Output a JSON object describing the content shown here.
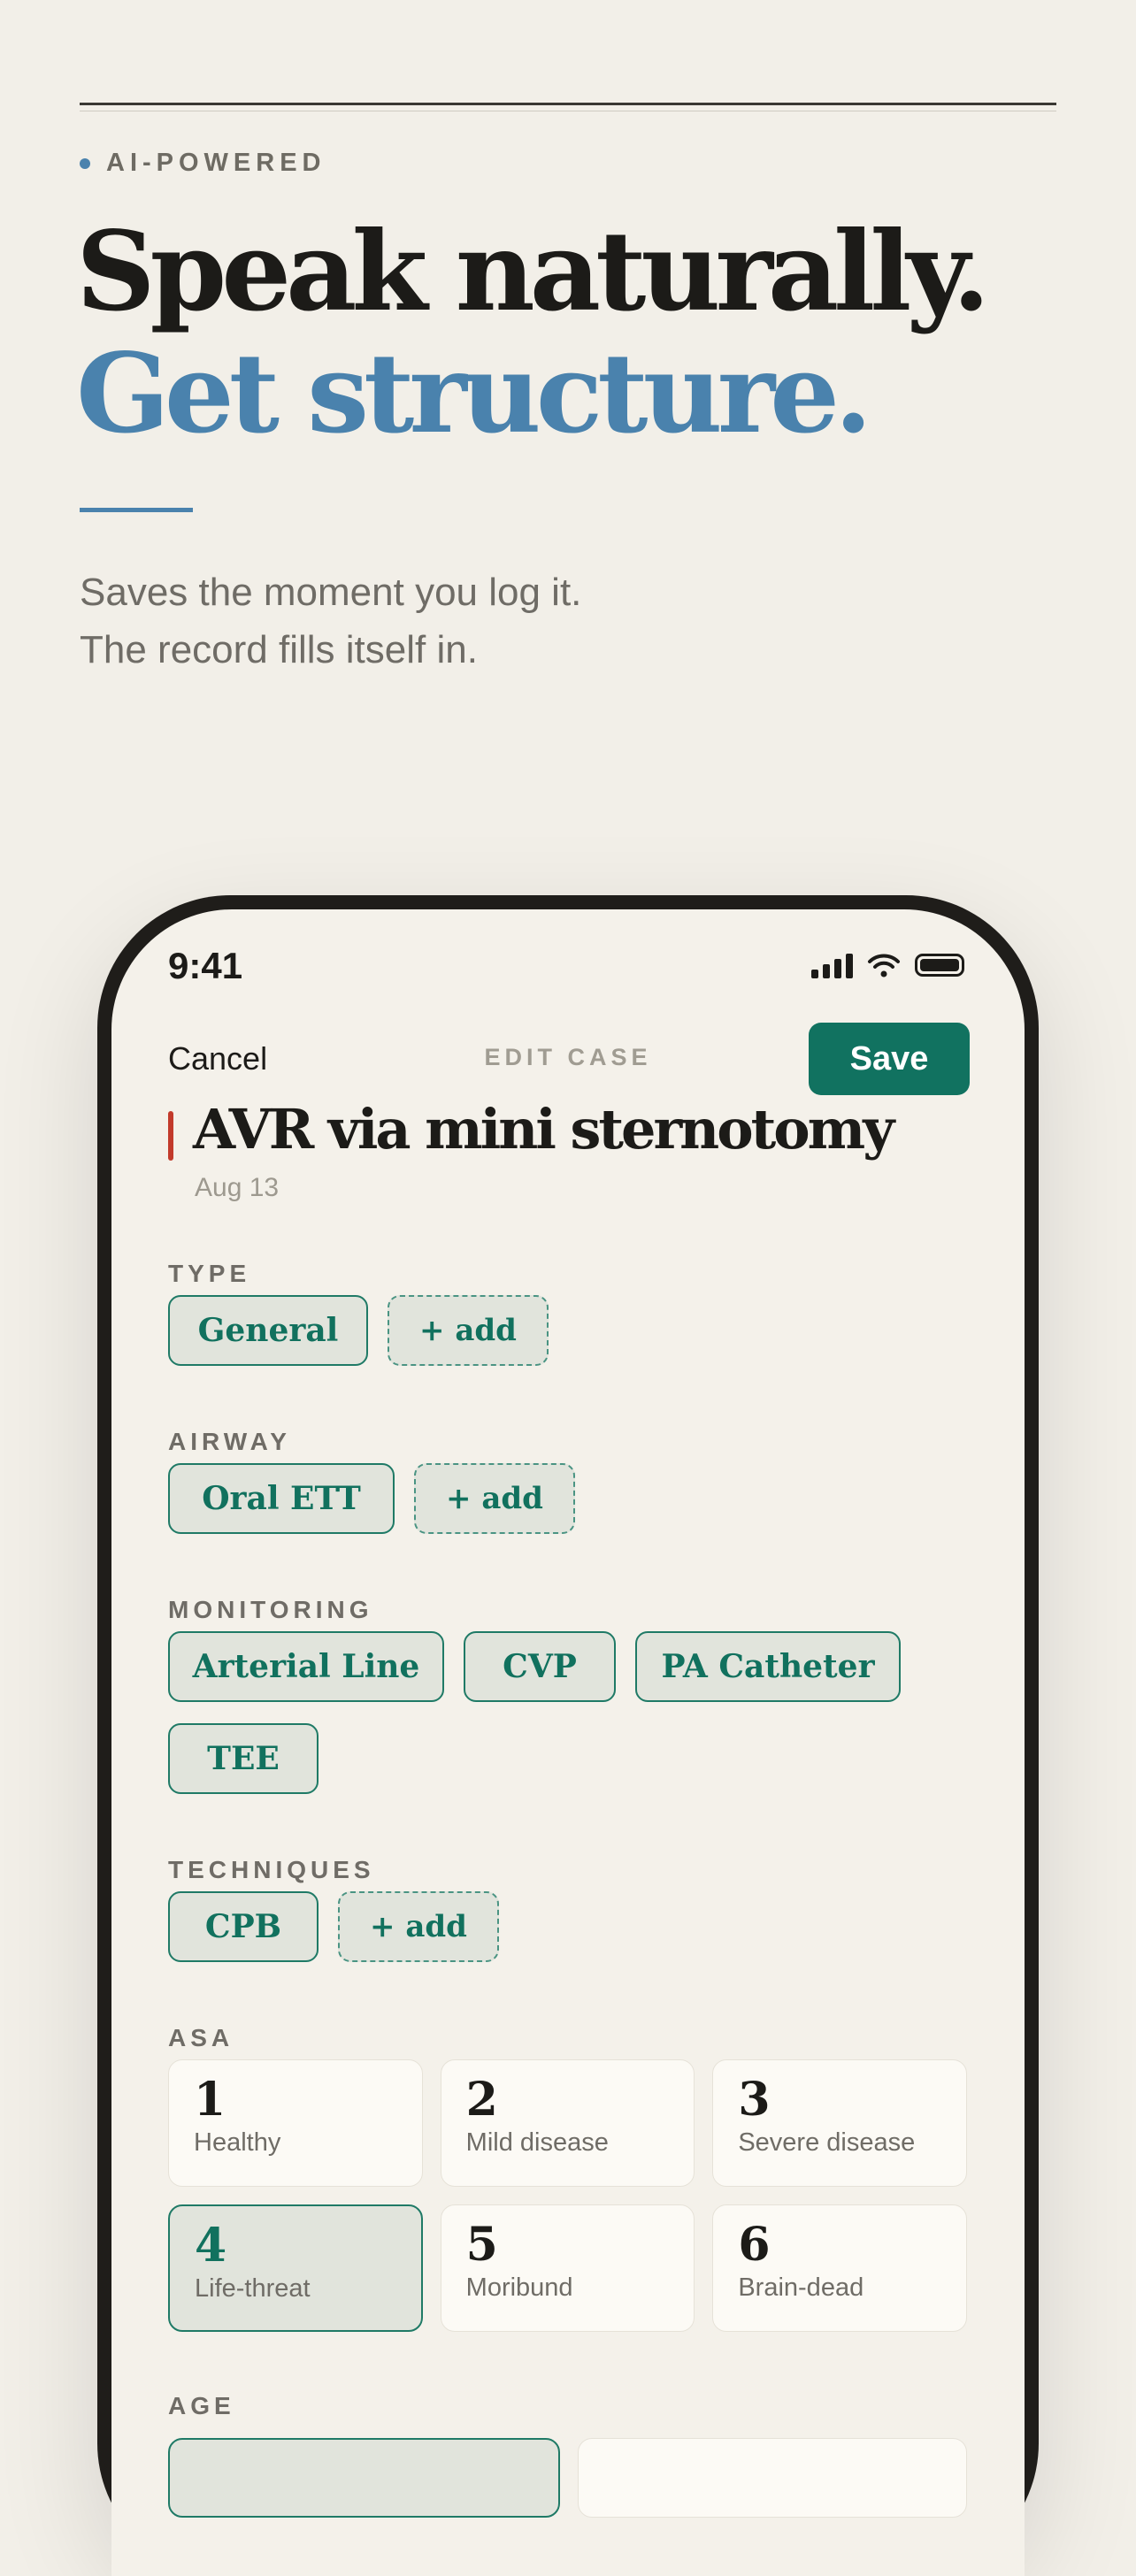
{
  "hero": {
    "eyebrow": "AI-POWERED",
    "headline_line1": "Speak naturally.",
    "headline_line2": "Get structure.",
    "sub_line1": "Saves the moment you log it.",
    "sub_line2": "The record fills itself in."
  },
  "status_bar": {
    "time": "9:41"
  },
  "nav": {
    "cancel": "Cancel",
    "title": "EDIT CASE",
    "save": "Save"
  },
  "case": {
    "title": "AVR via mini sternotomy",
    "date": "Aug 13"
  },
  "sections": {
    "type": {
      "label": "TYPE",
      "chips": [
        "General"
      ],
      "add": "+ add"
    },
    "airway": {
      "label": "AIRWAY",
      "chips": [
        "Oral ETT"
      ],
      "add": "+ add"
    },
    "monitoring": {
      "label": "MONITORING",
      "chips": [
        "Arterial Line",
        "CVP",
        "PA Catheter",
        "TEE"
      ]
    },
    "techniques": {
      "label": "TECHNIQUES",
      "chips": [
        "CPB"
      ],
      "add": "+ add"
    },
    "asa": {
      "label": "ASA",
      "options": [
        {
          "num": "1",
          "desc": "Healthy"
        },
        {
          "num": "2",
          "desc": "Mild disease"
        },
        {
          "num": "3",
          "desc": "Severe disease"
        },
        {
          "num": "4",
          "desc": "Life-threat"
        },
        {
          "num": "5",
          "desc": "Moribund"
        },
        {
          "num": "6",
          "desc": "Brain-dead"
        }
      ],
      "selected": "4"
    },
    "age": {
      "label": "AGE"
    }
  },
  "colors": {
    "accent_blue": "#4a82ad",
    "brand_green": "#117260",
    "marker_red": "#c23a2b",
    "background": "#f2efe8"
  },
  "icons": [
    "signal-icon",
    "wifi-icon",
    "battery-icon"
  ]
}
